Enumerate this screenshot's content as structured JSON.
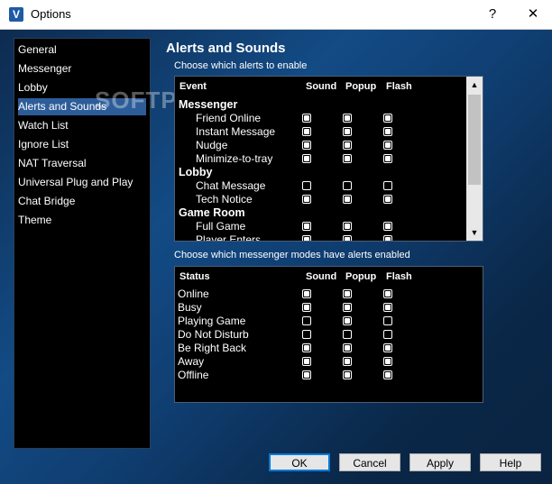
{
  "window": {
    "title": "Options",
    "help_label": "?",
    "close_label": "✕"
  },
  "sidebar": {
    "items": [
      {
        "label": "General"
      },
      {
        "label": "Messenger"
      },
      {
        "label": "Lobby"
      },
      {
        "label": "Alerts and Sounds",
        "selected": true
      },
      {
        "label": "Watch List"
      },
      {
        "label": "Ignore List"
      },
      {
        "label": "NAT Traversal"
      },
      {
        "label": "Universal Plug and Play"
      },
      {
        "label": "Chat Bridge"
      },
      {
        "label": "Theme"
      }
    ]
  },
  "panel": {
    "title": "Alerts and Sounds",
    "alerts_prompt": "Choose which alerts to enable",
    "modes_prompt": "Choose which messenger modes have alerts enabled"
  },
  "alerts_table": {
    "headers": {
      "event": "Event",
      "sound": "Sound",
      "popup": "Popup",
      "flash": "Flash"
    },
    "rows": [
      {
        "label": "Messenger",
        "group": true
      },
      {
        "label": "Friend Online",
        "sound": true,
        "popup": true,
        "flash": true
      },
      {
        "label": "Instant Message",
        "sound": true,
        "popup": true,
        "flash": true
      },
      {
        "label": "Nudge",
        "sound": true,
        "popup": true,
        "flash": true
      },
      {
        "label": "Minimize-to-tray",
        "sound": true,
        "popup": true,
        "flash": true
      },
      {
        "label": "Lobby",
        "group": true
      },
      {
        "label": "Chat Message",
        "sound": false,
        "popup": false,
        "flash": false
      },
      {
        "label": "Tech Notice",
        "sound": true,
        "popup": true,
        "flash": true
      },
      {
        "label": "Game Room",
        "group": true
      },
      {
        "label": "Full Game",
        "sound": true,
        "popup": true,
        "flash": true
      },
      {
        "label": "Player Enters",
        "sound": true,
        "popup": true,
        "flash": true
      }
    ]
  },
  "status_table": {
    "headers": {
      "status": "Status",
      "sound": "Sound",
      "popup": "Popup",
      "flash": "Flash"
    },
    "rows": [
      {
        "label": "Online",
        "sound": true,
        "popup": true,
        "flash": true
      },
      {
        "label": "Busy",
        "sound": true,
        "popup": true,
        "flash": true
      },
      {
        "label": "Playing Game",
        "sound": false,
        "popup": true,
        "flash": false
      },
      {
        "label": "Do Not Disturb",
        "sound": false,
        "popup": false,
        "flash": false
      },
      {
        "label": "Be Right Back",
        "sound": true,
        "popup": true,
        "flash": true
      },
      {
        "label": "Away",
        "sound": true,
        "popup": true,
        "flash": true
      },
      {
        "label": "Offline",
        "sound": true,
        "popup": true,
        "flash": true
      }
    ]
  },
  "buttons": {
    "ok": "OK",
    "cancel": "Cancel",
    "apply": "Apply",
    "help": "Help"
  },
  "watermark": "SOFTPEDIA"
}
